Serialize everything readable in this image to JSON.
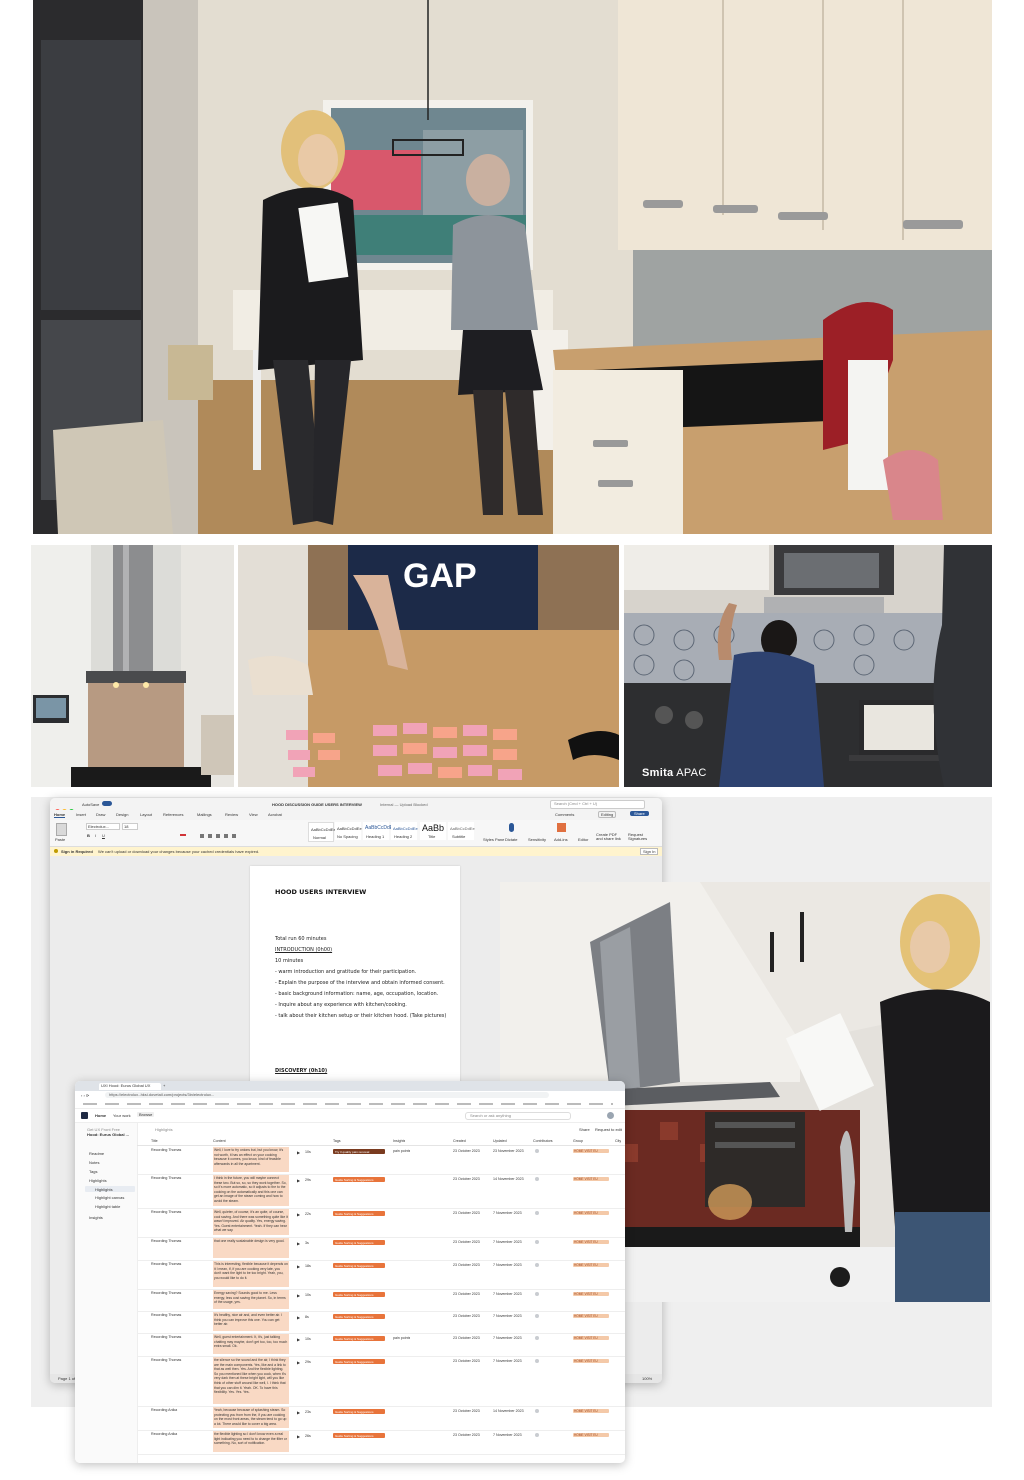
{
  "photos": {
    "hero": "Kitchen interview: researcher with discussion guide and participant",
    "hood": "Kitchen hood with lights over induction cooktop",
    "cards": "Participant sorting pink and orange cards on wooden table",
    "apac": "Participant reaching up to kitchen hood, laptop on counter",
    "apac_caption_brand": "Smita",
    "apac_caption_region": "APAC",
    "gap_shirt": "GAP",
    "hood2": "Researcher reading guide in kitchen with chimney hood"
  },
  "word": {
    "autosave": "AutoSave",
    "title": "HOOD DISCUSSION GUIDE USERS INTERVIEW",
    "status": "Internal — Upload Blocked",
    "search": "Search (Cmd + Ctrl + U)",
    "tabs": [
      "Home",
      "Insert",
      "Draw",
      "Design",
      "Layout",
      "References",
      "Mailings",
      "Review",
      "View",
      "Acrobat"
    ],
    "comments": "Comments",
    "editing": "Editing",
    "share": "Share",
    "font": "Electrolux...",
    "size": "18",
    "paste": "Paste",
    "styles": [
      "Normal",
      "No Spacing",
      "Heading 1",
      "Heading 2",
      "Title",
      "Subtitle"
    ],
    "style_preview": "AaBbCcDdEe",
    "title_preview": "AaBb",
    "ribbon_right": [
      "Styles Pane",
      "Dictate",
      "Sensitivity",
      "Add-ins",
      "Editor",
      "Create PDF and share link",
      "Request Signatures"
    ],
    "msg_bold": "Sign in Required",
    "msg": "We can't upload or download your changes because your cached credentials have expired.",
    "sign_in": "Sign In",
    "page_status": "Page 1 of 4",
    "zoom": "100%",
    "doc": {
      "heading": "HOOD USERS INTERVIEW",
      "total": "Total run 60 minutes",
      "intro": "INTRODUCTION (0h00)",
      "minutes": "10 minutes",
      "bullets": [
        "- warm introduction and gratitude for their participation.",
        "- Explain the purpose of the interview and obtain informed consent.",
        "- basic background information: name, age, occupation, location.",
        "- Inquire about any experience with kitchen/cooking.",
        "- talk about their kitchen setup or their kitchen hood. (Take pictures)"
      ],
      "discovery": "DISCOVERY (0h10)"
    }
  },
  "dovetail": {
    "tab_title": "UXI Hood: Eurus Global UX",
    "url": "https://electrolux.-hksi.dovetail.com/projects/3in/electrolux...",
    "nav": [
      "Home",
      "Your work",
      "Browse"
    ],
    "workspace_plan": "Get UX Front Free",
    "workspace": "Hood: Eurus Global ...",
    "sidebar": [
      "Readme",
      "Notes",
      "Tags",
      "Highlights",
      "Highlights",
      "Highlight canvas",
      "Highlight table",
      "Insights"
    ],
    "search": "Search or ask anything",
    "breadcrumb": "Highlights",
    "share": "Share",
    "request_edit": "Request to edit",
    "columns": [
      "Title",
      "Content",
      "Tags",
      "Insights",
      "Created",
      "Updated",
      "Contributors",
      "Group",
      "City"
    ],
    "rows": [
      {
        "title": "Recording Thomas",
        "content": "Well, I love to fry onions but, but you know, it's not worth, it has an effect on your cooking because it comes, you know, kind of feasible afterwards in all the apartment.",
        "dur": "10s",
        "tag": "Try 3 quality pain removal",
        "insight": "pain points",
        "created": "23 October 2023",
        "updated": "23 November 2023",
        "group": "HOME VISIT EU"
      },
      {
        "title": "Recording Thomas",
        "content": "I think in the future, you will maybe connect these two. But so, so, so they work together. So, so it's more automatic, so it adjusts to the to the cooking on the automatically and this one can get an image of the steam coming and how to avoid the steam.",
        "dur": "29s",
        "tag": "Guide Sorting & Suggestions",
        "insight": "",
        "created": "23 October 2023",
        "updated": "14 November 2023",
        "group": "HOME VISIT EU"
      },
      {
        "title": "Recording Thomas",
        "content": "Well, quieter, of course, it's an quite, of course, cool saving. And there was something quite like it wasn't improved. Air quality. Yes, energy saving. Yes. Guest entertainment. Yeah. If they can hear what we say.",
        "dur": "22s",
        "tag": "Guide Sorting & Suggestions",
        "insight": "",
        "created": "23 October 2023",
        "updated": "7 November 2023",
        "group": "HOME VISIT EU"
      },
      {
        "title": "Recording Thomas",
        "content": "that one really sustainable design is very good.",
        "dur": "3s",
        "tag": "Guide Sorting & Suggestions",
        "insight": "",
        "created": "23 October 2023",
        "updated": "7 November 2023",
        "group": "HOME VISIT EU"
      },
      {
        "title": "Recording Thomas",
        "content": "This is interesting, flexible because it depends on it I mean, if, if you are cooking very late, you don't want the light to be too bright. Yeah, you, you would like to do it.",
        "dur": "18s",
        "tag": "Guide Sorting & Suggestions",
        "insight": "",
        "created": "23 October 2023",
        "updated": "7 November 2023",
        "group": "HOME VISIT EU"
      },
      {
        "title": "Recording Thomas",
        "content": "Energy saving? Sounds good to me. Less energy, less cost saving the planet. So, in terms of the usage, yes.",
        "dur": "10s",
        "tag": "Guide Sorting & Suggestions",
        "insight": "",
        "created": "23 October 2023",
        "updated": "7 November 2023",
        "group": "HOME VISIT EU"
      },
      {
        "title": "Recording Thomas",
        "content": "It's healthy, nice air and, and even better air. I think you can improve this one. You can get better air.",
        "dur": "8s",
        "tag": "Guide Sorting & Suggestions",
        "insight": "",
        "created": "23 October 2023",
        "updated": "7 November 2023",
        "group": "HOME VISIT EU"
      },
      {
        "title": "Recording Thomas",
        "content": "Well, guest entertainment. It, it's, just talking chatting may maybe, don't get too, too, too much extra small. Ok.",
        "dur": "10s",
        "tag": "Guide Sorting & Suggestions",
        "insight": "pain points",
        "created": "23 October 2023",
        "updated": "7 November 2023",
        "group": "HOME VISIT EU"
      },
      {
        "title": "Recording Thomas",
        "content": "the silence so the sound and the air, I think they are the main components. Yes, like and a link to that as well then. Yes. And the flexible lighting. So you mentioned like when you cook, when it's very dark then at these bright light, will you like think of other stuff around like well, I. I think that that you can dim it. Yeah. OK. To have this flexibility. Yes. Yes. Yes.",
        "dur": "29s",
        "tag": "Guide Sorting & Suggestions",
        "insight": "",
        "created": "23 October 2023",
        "updated": "7 November 2023",
        "group": "HOME VISIT EU"
      },
      {
        "title": "Recording Anika",
        "content": "Yeah, because because of splashing steam. So protecting you from from the, if you are cooking on the most front areas, the steam tend to go up a lot. There would like to cover a big area.",
        "dur": "23s",
        "tag": "Guide Sorting & Suggestions",
        "insight": "",
        "created": "23 October 2023",
        "updated": "14 November 2023",
        "group": "HOME VISIT EU"
      },
      {
        "title": "Recording Anika",
        "content": "the flexible lighting so I don't know even a real light indicating you need to to change the filter or something. No, sort of notification.",
        "dur": "26s",
        "tag": "Guide Sorting & Suggestions",
        "insight": "",
        "created": "23 October 2023",
        "updated": "7 November 2023",
        "group": "HOME VISIT EU"
      }
    ]
  }
}
